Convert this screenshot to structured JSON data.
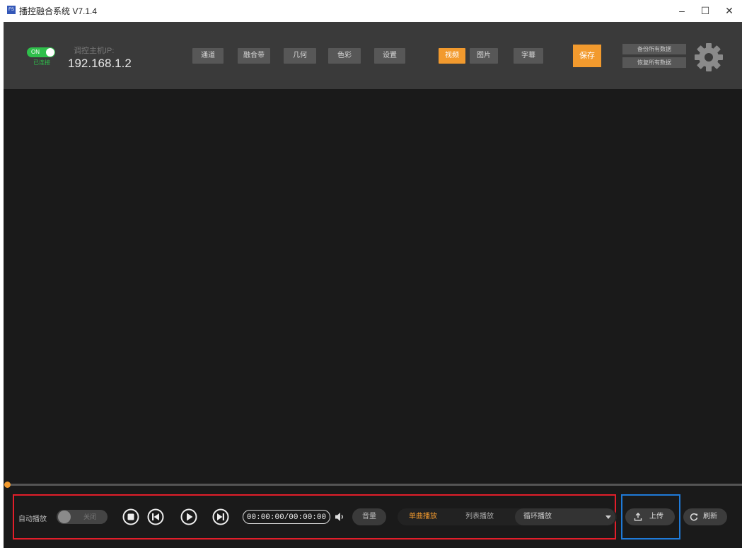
{
  "window": {
    "icon_text": "FS",
    "title": "播控融合系统 V7.1.4",
    "minimize": "–",
    "maximize": "☐",
    "close": "✕"
  },
  "connection": {
    "toggle_label": "ON",
    "status": "已连接",
    "ip_label": "调控主机IP:",
    "ip_value": "192.168.1.2"
  },
  "toolbar": {
    "buttons": [
      "通道",
      "融合带",
      "几何",
      "色彩",
      "设置"
    ],
    "media_buttons": [
      "视频",
      "图片",
      "字幕"
    ],
    "active_media": "视频",
    "save": "保存",
    "backup": "备份所有数据",
    "restore": "恢复所有数据"
  },
  "playback": {
    "progress": 0.0,
    "auto_play_label": "自动播放",
    "auto_play_state": "关闭",
    "time": "00:00:00/00:00:00",
    "volume_button": "音量",
    "modes": [
      "单曲播放",
      "列表播放"
    ],
    "active_mode": "单曲播放",
    "loop_select": "循环播放",
    "upload": "上传",
    "refresh": "刷新"
  },
  "colors": {
    "accent": "#f29a2e",
    "on_green": "#2fbf4b",
    "highlight_red": "#e21e2a",
    "highlight_blue": "#1f7ad8"
  }
}
